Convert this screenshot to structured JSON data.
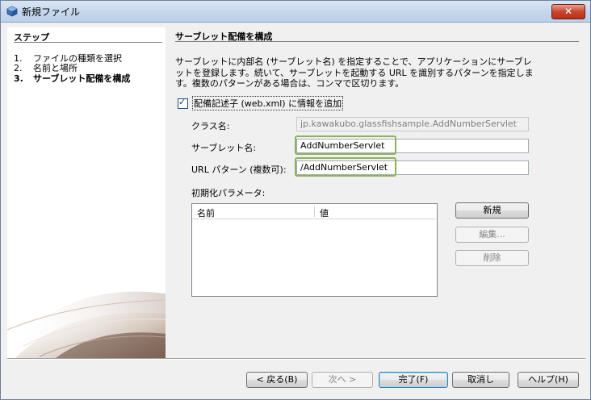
{
  "window": {
    "title": "新規ファイル",
    "close_label": "✕"
  },
  "steps": {
    "heading": "ステップ",
    "items": [
      {
        "num": "1.",
        "label": "ファイルの種類を選択"
      },
      {
        "num": "2.",
        "label": "名前と場所"
      },
      {
        "num": "3.",
        "label": "サーブレット配備を構成"
      }
    ]
  },
  "content": {
    "title": "サーブレット配備を構成",
    "description": "サーブレットに内部名 (サーブレット名) を指定することで、アプリケーションにサーブレットを登録します。続いて、サーブレットを起動する URL を識別するパターンを指定します。複数のパターンがある場合は、コンマで区切ります。",
    "checkbox_label": "配備記述子 (web.xml) に情報を追加",
    "checkbox_checked": true,
    "class_name_label": "クラス名:",
    "class_name_value": "jp.kawakubo.glassfishsample.AddNumberServlet",
    "servlet_name_label": "サーブレット名:",
    "servlet_name_value": "AddNumberServlet",
    "url_pattern_label": "URL パターン (複数可):",
    "url_pattern_value": "/AddNumberServlet",
    "init_params_label": "初期化パラメータ:",
    "table_headers": [
      "名前",
      "値"
    ],
    "new_button": "新規",
    "edit_button": "編集...",
    "delete_button": "削除"
  },
  "footer": {
    "back": "< 戻る(B)",
    "next": "次へ >",
    "finish": "完了(F)",
    "cancel": "取消し",
    "help": "ヘルプ(H)"
  },
  "colors": {
    "highlight": "#8cb35a",
    "title_bar": "#c6d7ec",
    "close_button": "#c9452b"
  }
}
